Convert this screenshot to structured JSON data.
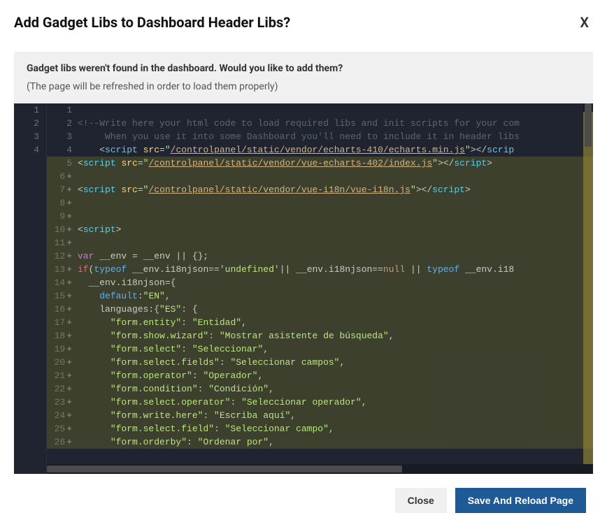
{
  "modal": {
    "title": "Add Gadget Libs to Dashboard Header Libs?",
    "closeX": "X",
    "infoPrimary": "Gadget libs weren't found in the dashboard. Would you like to add them?",
    "infoSecondary": "(The page will be refreshed in order to load them properly)"
  },
  "diff": {
    "leftNumbers": [
      "1",
      "2",
      "3",
      "4",
      "",
      "",
      "",
      "",
      "",
      "",
      "",
      "",
      "",
      "",
      "",
      "",
      "",
      "",
      "",
      "",
      "",
      "",
      "",
      "",
      "",
      "",
      ""
    ],
    "rows": [
      {
        "n": "1",
        "plus": false,
        "added": false,
        "tokens": []
      },
      {
        "n": "2",
        "plus": false,
        "added": false,
        "tokens": [
          {
            "t": "<!--",
            "c": "tok-comment"
          },
          {
            "t": "Write here your html code to load required libs and init scripts for your com",
            "c": "tok-comment"
          }
        ]
      },
      {
        "n": "3",
        "plus": false,
        "added": false,
        "tokens": [
          {
            "t": "     When you use it into some Dashboard you'll need to include it in header libs",
            "c": "tok-comment"
          }
        ]
      },
      {
        "n": "4",
        "plus": false,
        "added": false,
        "tokens": [
          {
            "t": "    <",
            "c": ""
          },
          {
            "t": "script",
            "c": "tok-tag"
          },
          {
            "t": " ",
            "c": ""
          },
          {
            "t": "src",
            "c": "tok-attr"
          },
          {
            "t": "=",
            "c": ""
          },
          {
            "t": "\"",
            "c": "tok-str"
          },
          {
            "t": "/controlpanel/static/vendor/echarts-410/echarts.min.js",
            "c": "tok-url"
          },
          {
            "t": "\"",
            "c": "tok-str"
          },
          {
            "t": "></",
            "c": ""
          },
          {
            "t": "scrip",
            "c": "tok-tag"
          }
        ]
      },
      {
        "n": "5",
        "plus": false,
        "added": true,
        "tokens": [
          {
            "t": "<",
            "c": ""
          },
          {
            "t": "script",
            "c": "tok-tag"
          },
          {
            "t": " ",
            "c": ""
          },
          {
            "t": "src",
            "c": "tok-attr"
          },
          {
            "t": "=",
            "c": ""
          },
          {
            "t": "\"",
            "c": "tok-str"
          },
          {
            "t": "/controlpanel/static/vendor/vue-echarts-402/index.js",
            "c": "tok-url"
          },
          {
            "t": "\"",
            "c": "tok-str"
          },
          {
            "t": "></",
            "c": ""
          },
          {
            "t": "script",
            "c": "tok-tag"
          },
          {
            "t": ">",
            "c": ""
          }
        ]
      },
      {
        "n": "6",
        "plus": true,
        "added": true,
        "tokens": []
      },
      {
        "n": "7",
        "plus": true,
        "added": true,
        "tokens": [
          {
            "t": "<",
            "c": ""
          },
          {
            "t": "script",
            "c": "tok-tag"
          },
          {
            "t": " ",
            "c": ""
          },
          {
            "t": "src",
            "c": "tok-attr"
          },
          {
            "t": "=",
            "c": ""
          },
          {
            "t": "\"",
            "c": "tok-str"
          },
          {
            "t": "/controlpanel/static/vendor/vue-i18n/vue-i18n.js",
            "c": "tok-url"
          },
          {
            "t": "\"",
            "c": "tok-str"
          },
          {
            "t": "></",
            "c": ""
          },
          {
            "t": "script",
            "c": "tok-tag"
          },
          {
            "t": ">",
            "c": ""
          }
        ]
      },
      {
        "n": "8",
        "plus": true,
        "added": true,
        "tokens": []
      },
      {
        "n": "9",
        "plus": true,
        "added": true,
        "tokens": []
      },
      {
        "n": "10",
        "plus": true,
        "added": true,
        "tokens": [
          {
            "t": "<",
            "c": ""
          },
          {
            "t": "script",
            "c": "tok-tag"
          },
          {
            "t": ">",
            "c": ""
          }
        ]
      },
      {
        "n": "11",
        "plus": true,
        "added": true,
        "tokens": []
      },
      {
        "n": "12",
        "plus": true,
        "added": true,
        "tokens": [
          {
            "t": "var",
            "c": "tok-kw"
          },
          {
            "t": " __env = __env || {};",
            "c": ""
          }
        ]
      },
      {
        "n": "13",
        "plus": true,
        "added": true,
        "tokens": [
          {
            "t": "if",
            "c": "tok-kw2"
          },
          {
            "t": "(",
            "c": ""
          },
          {
            "t": "typeof",
            "c": "tok-fn"
          },
          {
            "t": " __env.i18njson==",
            "c": ""
          },
          {
            "t": "'undefined'",
            "c": "tok-str"
          },
          {
            "t": "|| __env.i18njson==",
            "c": ""
          },
          {
            "t": "null",
            "c": "tok-null"
          },
          {
            "t": " || ",
            "c": ""
          },
          {
            "t": "typeof",
            "c": "tok-fn"
          },
          {
            "t": " __env.i18",
            "c": ""
          }
        ]
      },
      {
        "n": "14",
        "plus": true,
        "added": true,
        "tokens": [
          {
            "t": "  __env.i18njson={",
            "c": ""
          }
        ]
      },
      {
        "n": "15",
        "plus": true,
        "added": true,
        "tokens": [
          {
            "t": "    ",
            "c": ""
          },
          {
            "t": "default",
            "c": "tok-fn"
          },
          {
            "t": ":",
            "c": ""
          },
          {
            "t": "\"EN\"",
            "c": "tok-str"
          },
          {
            "t": ",",
            "c": ""
          }
        ]
      },
      {
        "n": "16",
        "plus": true,
        "added": true,
        "tokens": [
          {
            "t": "    languages:{",
            "c": ""
          },
          {
            "t": "\"ES\"",
            "c": "tok-prop"
          },
          {
            "t": ": {",
            "c": ""
          }
        ]
      },
      {
        "n": "17",
        "plus": true,
        "added": true,
        "tokens": [
          {
            "t": "      ",
            "c": ""
          },
          {
            "t": "\"form.entity\"",
            "c": "tok-prop"
          },
          {
            "t": ": ",
            "c": ""
          },
          {
            "t": "\"Entidad\"",
            "c": "tok-val"
          },
          {
            "t": ",",
            "c": ""
          }
        ]
      },
      {
        "n": "18",
        "plus": true,
        "added": true,
        "tokens": [
          {
            "t": "      ",
            "c": ""
          },
          {
            "t": "\"form.show.wizard\"",
            "c": "tok-prop"
          },
          {
            "t": ": ",
            "c": ""
          },
          {
            "t": "\"Mostrar asistente de búsqueda\"",
            "c": "tok-val"
          },
          {
            "t": ",",
            "c": ""
          }
        ]
      },
      {
        "n": "19",
        "plus": true,
        "added": true,
        "tokens": [
          {
            "t": "      ",
            "c": ""
          },
          {
            "t": "\"form.select\"",
            "c": "tok-prop"
          },
          {
            "t": ": ",
            "c": ""
          },
          {
            "t": "\"Seleccionar\"",
            "c": "tok-val"
          },
          {
            "t": ",",
            "c": ""
          }
        ]
      },
      {
        "n": "20",
        "plus": true,
        "added": true,
        "tokens": [
          {
            "t": "      ",
            "c": ""
          },
          {
            "t": "\"form.select.fields\"",
            "c": "tok-prop"
          },
          {
            "t": ": ",
            "c": ""
          },
          {
            "t": "\"Seleccionar campos\"",
            "c": "tok-val"
          },
          {
            "t": ",",
            "c": ""
          }
        ]
      },
      {
        "n": "21",
        "plus": true,
        "added": true,
        "tokens": [
          {
            "t": "      ",
            "c": ""
          },
          {
            "t": "\"form.operator\"",
            "c": "tok-prop"
          },
          {
            "t": ": ",
            "c": ""
          },
          {
            "t": "\"Operador\"",
            "c": "tok-val"
          },
          {
            "t": ",",
            "c": ""
          }
        ]
      },
      {
        "n": "22",
        "plus": true,
        "added": true,
        "tokens": [
          {
            "t": "      ",
            "c": ""
          },
          {
            "t": "\"form.condition\"",
            "c": "tok-prop"
          },
          {
            "t": ": ",
            "c": ""
          },
          {
            "t": "\"Condición\"",
            "c": "tok-val"
          },
          {
            "t": ",",
            "c": ""
          }
        ]
      },
      {
        "n": "23",
        "plus": true,
        "added": true,
        "tokens": [
          {
            "t": "      ",
            "c": ""
          },
          {
            "t": "\"form.select.operator\"",
            "c": "tok-prop"
          },
          {
            "t": ": ",
            "c": ""
          },
          {
            "t": "\"Seleccionar operador\"",
            "c": "tok-val"
          },
          {
            "t": ",",
            "c": ""
          }
        ]
      },
      {
        "n": "24",
        "plus": true,
        "added": true,
        "tokens": [
          {
            "t": "      ",
            "c": ""
          },
          {
            "t": "\"form.write.here\"",
            "c": "tok-prop"
          },
          {
            "t": ": ",
            "c": ""
          },
          {
            "t": "\"Escriba aquí\"",
            "c": "tok-val"
          },
          {
            "t": ",",
            "c": ""
          }
        ]
      },
      {
        "n": "25",
        "plus": true,
        "added": true,
        "tokens": [
          {
            "t": "      ",
            "c": ""
          },
          {
            "t": "\"form.select.field\"",
            "c": "tok-prop"
          },
          {
            "t": ": ",
            "c": ""
          },
          {
            "t": "\"Seleccionar campo\"",
            "c": "tok-val"
          },
          {
            "t": ",",
            "c": ""
          }
        ]
      },
      {
        "n": "26",
        "plus": true,
        "added": true,
        "tokens": [
          {
            "t": "      ",
            "c": ""
          },
          {
            "t": "\"form.orderby\"",
            "c": "tok-prop"
          },
          {
            "t": ": ",
            "c": ""
          },
          {
            "t": "\"Ordenar por\"",
            "c": "tok-val"
          },
          {
            "t": ",",
            "c": ""
          }
        ]
      }
    ]
  },
  "footer": {
    "close": "Close",
    "save": "Save And Reload Page"
  }
}
